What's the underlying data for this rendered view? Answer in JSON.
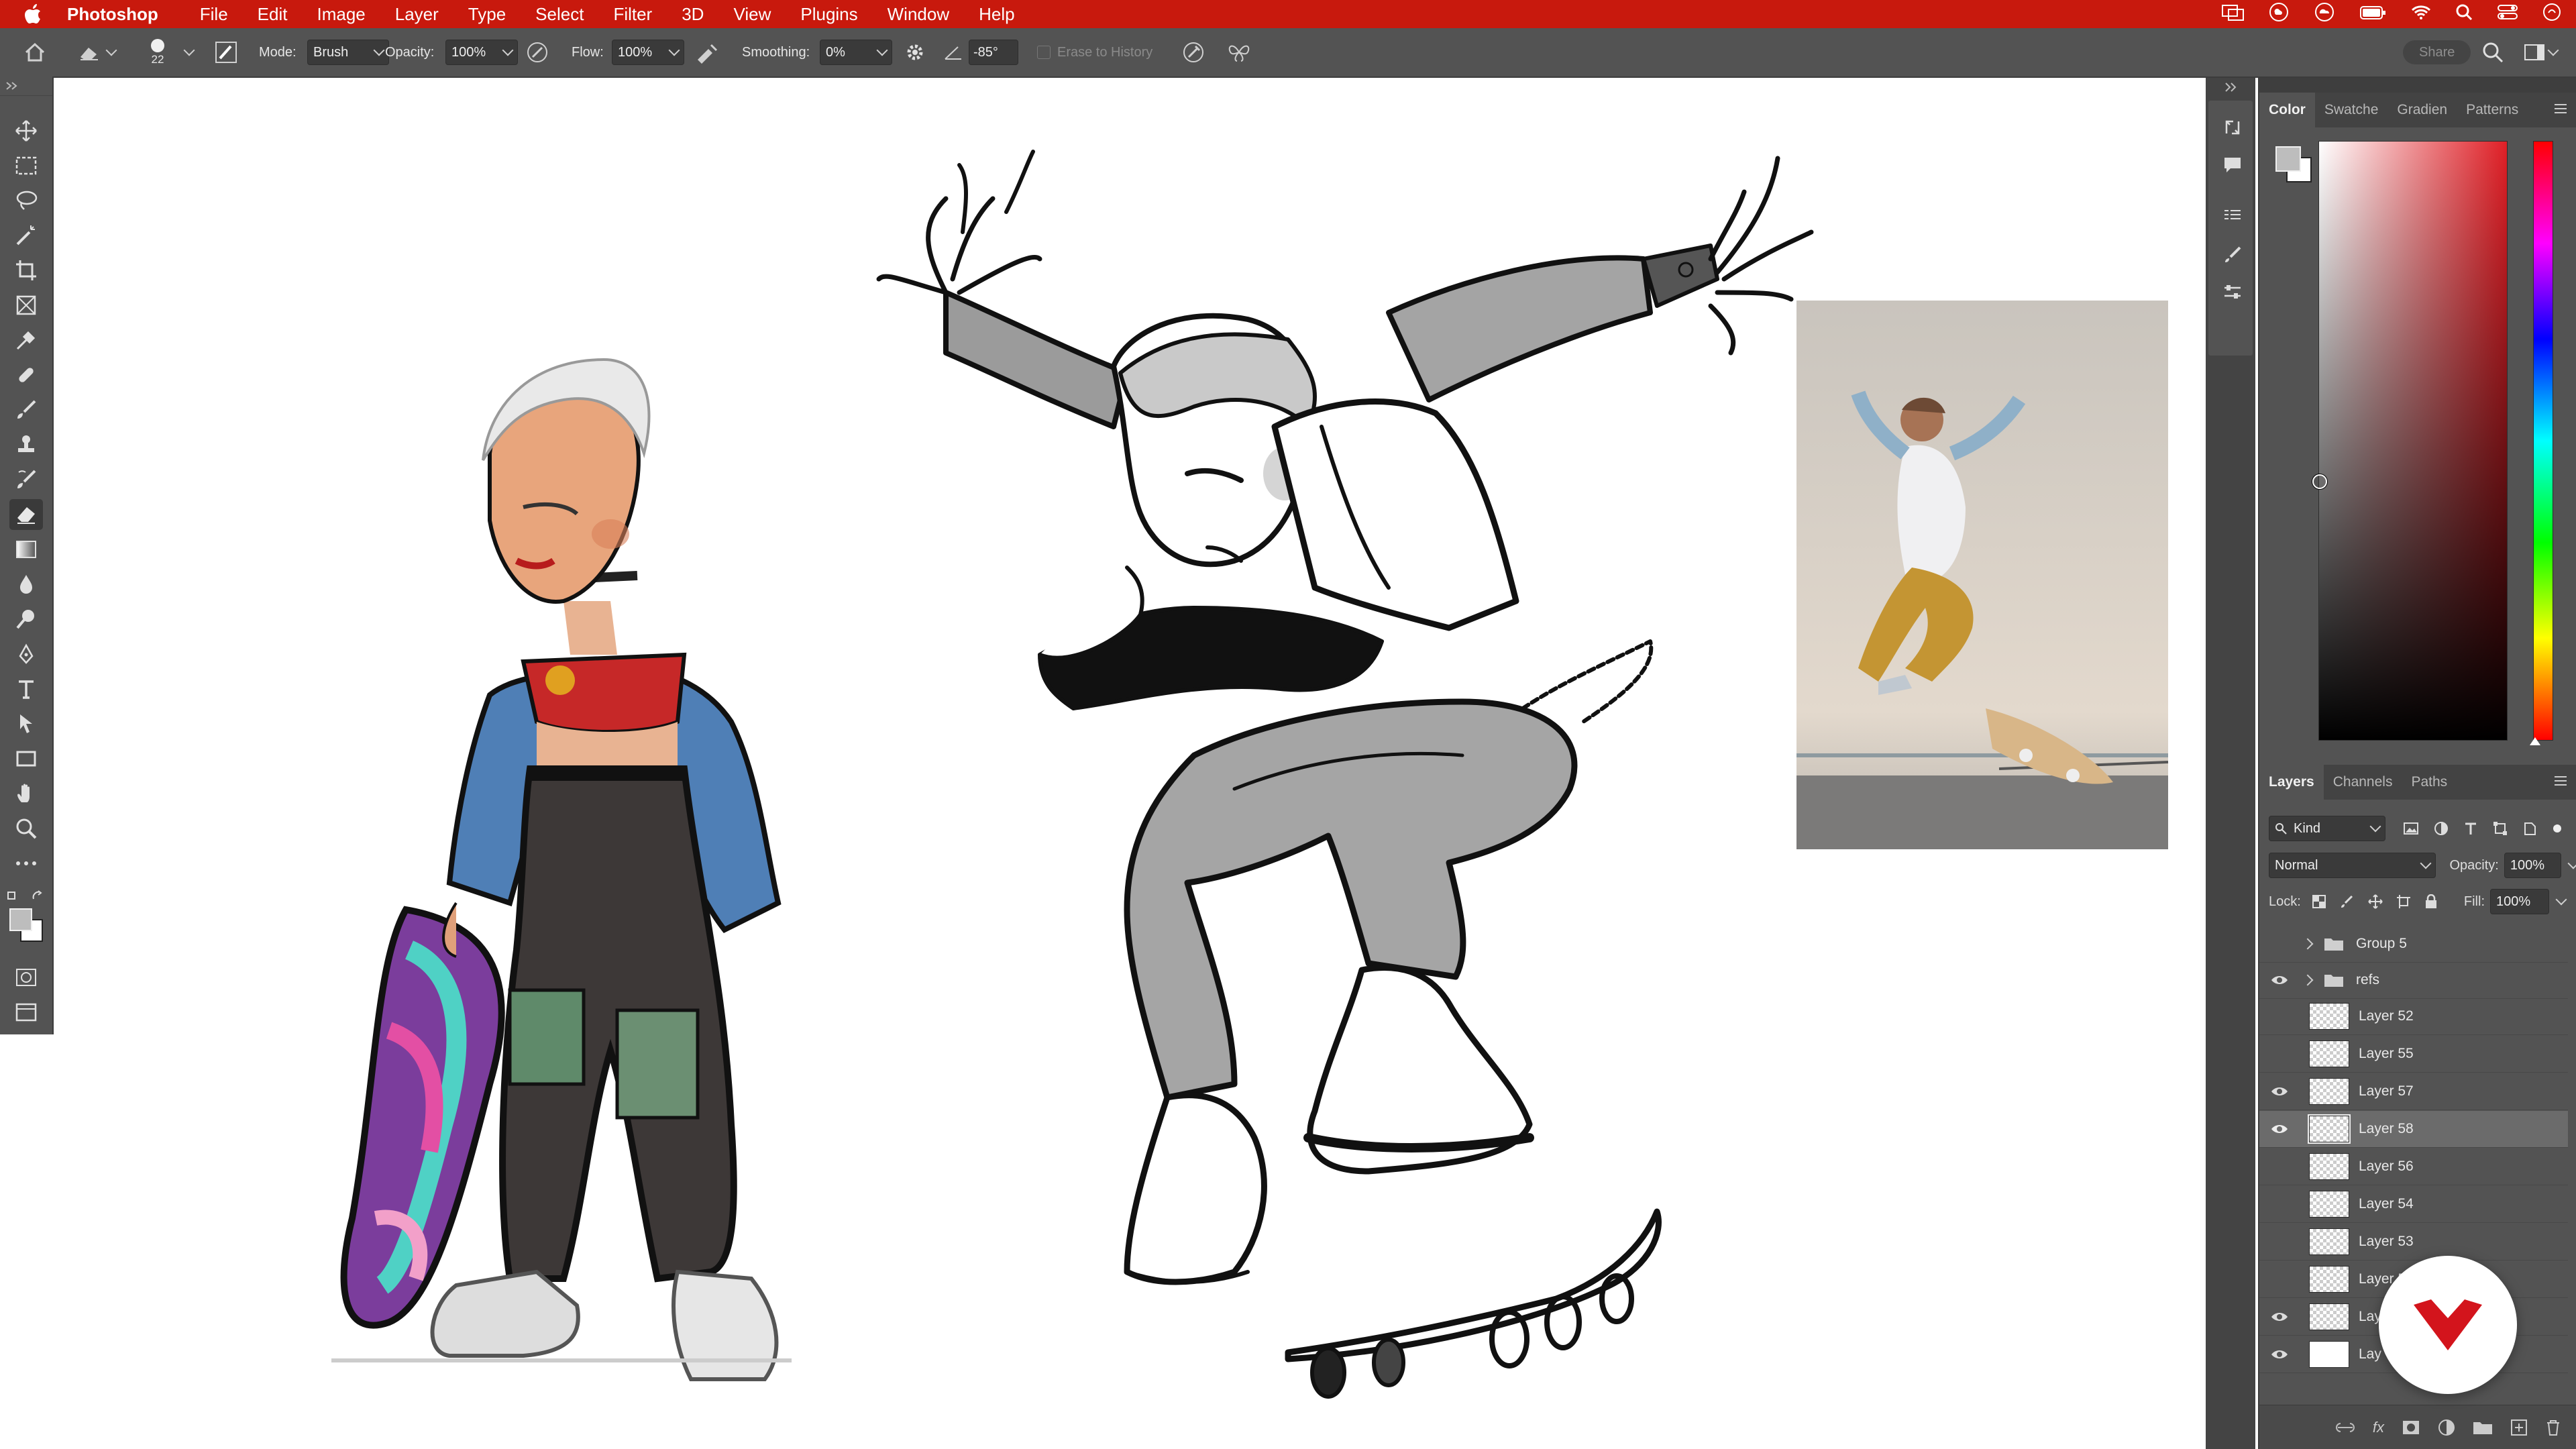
{
  "menubar": {
    "app": "Photoshop",
    "items": [
      "File",
      "Edit",
      "Image",
      "Layer",
      "Type",
      "Select",
      "Filter",
      "3D",
      "View",
      "Plugins",
      "Window",
      "Help"
    ],
    "bg_color": "#c8190d"
  },
  "options": {
    "brush_size": "22",
    "mode_label": "Mode:",
    "mode_value": "Brush",
    "opacity_label": "Opacity:",
    "opacity_value": "100%",
    "flow_label": "Flow:",
    "flow_value": "100%",
    "smoothing_label": "Smoothing:",
    "smoothing_value": "0%",
    "angle_value": "-85°",
    "erase_history": "Erase to History",
    "share": "Share"
  },
  "tools": [
    "move",
    "marquee",
    "lasso",
    "magic-wand",
    "crop",
    "frame",
    "eyedropper",
    "healing",
    "brush",
    "stamp",
    "history-brush",
    "eraser",
    "gradient",
    "blur",
    "dodge",
    "pen",
    "type",
    "path-select",
    "rectangle",
    "hand",
    "zoom",
    "more"
  ],
  "color_panel": {
    "tabs": [
      "Color",
      "Swatche",
      "Gradien",
      "Patterns"
    ],
    "selected_tab": "Color",
    "hue_color": "#e01f26"
  },
  "layers_panel": {
    "tabs": [
      "Layers",
      "Channels",
      "Paths"
    ],
    "selected_tab": "Layers",
    "filter_kind": "Kind",
    "blend_mode": "Normal",
    "opacity_label": "Opacity:",
    "opacity_value": "100%",
    "lock_label": "Lock:",
    "fill_label": "Fill:",
    "fill_value": "100%",
    "layers": [
      {
        "name": "Group 5",
        "type": "group",
        "visible": false
      },
      {
        "name": "refs",
        "type": "group",
        "visible": true
      },
      {
        "name": "Layer 52",
        "type": "layer",
        "visible": false
      },
      {
        "name": "Layer 55",
        "type": "layer",
        "visible": false
      },
      {
        "name": "Layer 57",
        "type": "layer",
        "visible": true
      },
      {
        "name": "Layer 58",
        "type": "layer",
        "visible": true,
        "selected": true
      },
      {
        "name": "Layer 56",
        "type": "layer",
        "visible": false
      },
      {
        "name": "Layer 54",
        "type": "layer",
        "visible": false
      },
      {
        "name": "Layer 53",
        "type": "layer",
        "visible": false
      },
      {
        "name": "Layer 5",
        "type": "layer",
        "visible": false
      },
      {
        "name": "Lay",
        "type": "layer",
        "visible": true
      },
      {
        "name": "Lay",
        "type": "layer",
        "visible": true
      }
    ]
  },
  "badge_color": "#d3141c"
}
